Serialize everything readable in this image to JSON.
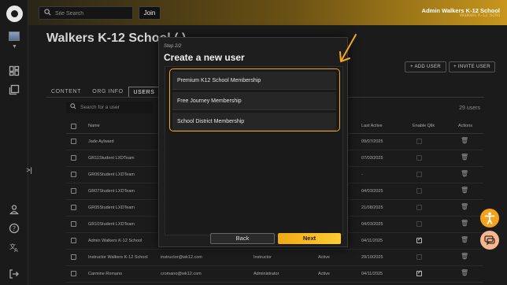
{
  "header": {
    "search_placeholder": "Site Search",
    "join_label": "Join",
    "user_name": "Admin Walkers K-12 School",
    "user_sub": "Walkers K-12 Scho"
  },
  "page": {
    "title": "Walkers K-12 School (",
    "title_suffix": ")",
    "add_user_label": "+ ADD USER",
    "invite_user_label": "+ INVITE USER"
  },
  "tabs": [
    {
      "label": "CONTENT"
    },
    {
      "label": "ORG INFO"
    },
    {
      "label": "USERS"
    }
  ],
  "table": {
    "search_placeholder": "Search for a user",
    "count": "29 users",
    "headers": {
      "name": "Name",
      "last_active": "Last Active",
      "qlik": "Enable Qlik",
      "actions": "Actions"
    },
    "rows": [
      {
        "name": "Jade Aylward",
        "email": "",
        "role": "",
        "status": "",
        "last_active": "09/07/2025",
        "qlik": false
      },
      {
        "name": "GR11Student LXDTeam",
        "email": "",
        "role": "",
        "status": "",
        "last_active": "07/03/2025",
        "qlik": false
      },
      {
        "name": "GR06Student LXDTeam",
        "email": "",
        "role": "",
        "status": "",
        "last_active": "-",
        "qlik": false
      },
      {
        "name": "GR07Student LXDTeam",
        "email": "",
        "role": "",
        "status": "",
        "last_active": "04/03/2025",
        "qlik": false
      },
      {
        "name": "GR05Student LXDTeam",
        "email": "",
        "role": "",
        "status": "",
        "last_active": "21/08/2025",
        "qlik": false
      },
      {
        "name": "GR10Student LXDTeam",
        "email": "",
        "role": "",
        "status": "",
        "last_active": "04/03/2025",
        "qlik": false
      },
      {
        "name": "Admin Walkers K-12 School",
        "email": "",
        "role": "",
        "status": "",
        "last_active": "04/11/2025",
        "qlik": true
      },
      {
        "name": "Instructor Walkers K-12 School",
        "email": "instructor@wk12.com",
        "role": "Instructor",
        "status": "Active",
        "last_active": "29/10/2025",
        "qlik": false
      },
      {
        "name": "Carmine Romano",
        "email": "cromano@wk12.com",
        "role": "Administrator",
        "status": "Active",
        "last_active": "04/11/2025",
        "qlik": true
      }
    ]
  },
  "modal": {
    "step": "Step 2/2",
    "title": "Create a new user",
    "options": [
      {
        "label": "Premium K12 School Membership"
      },
      {
        "label": "Free Journey Membership"
      },
      {
        "label": "School District Membership"
      }
    ],
    "back_label": "Back",
    "next_label": "Next"
  },
  "colors": {
    "accent": "#f3a722",
    "next_button": "#ffcc33",
    "accessibility_fab": "#f2a21c",
    "chat_fab": "#f6b790"
  },
  "icons": [
    "logo-icon",
    "dashboard-icon",
    "library-icon",
    "collapse-sidebar-icon",
    "profile-icon",
    "help-icon",
    "translate-icon",
    "logout-icon",
    "search-icon",
    "trash-icon",
    "accessibility-icon",
    "chat-icon",
    "arrow-annotation-icon"
  ]
}
